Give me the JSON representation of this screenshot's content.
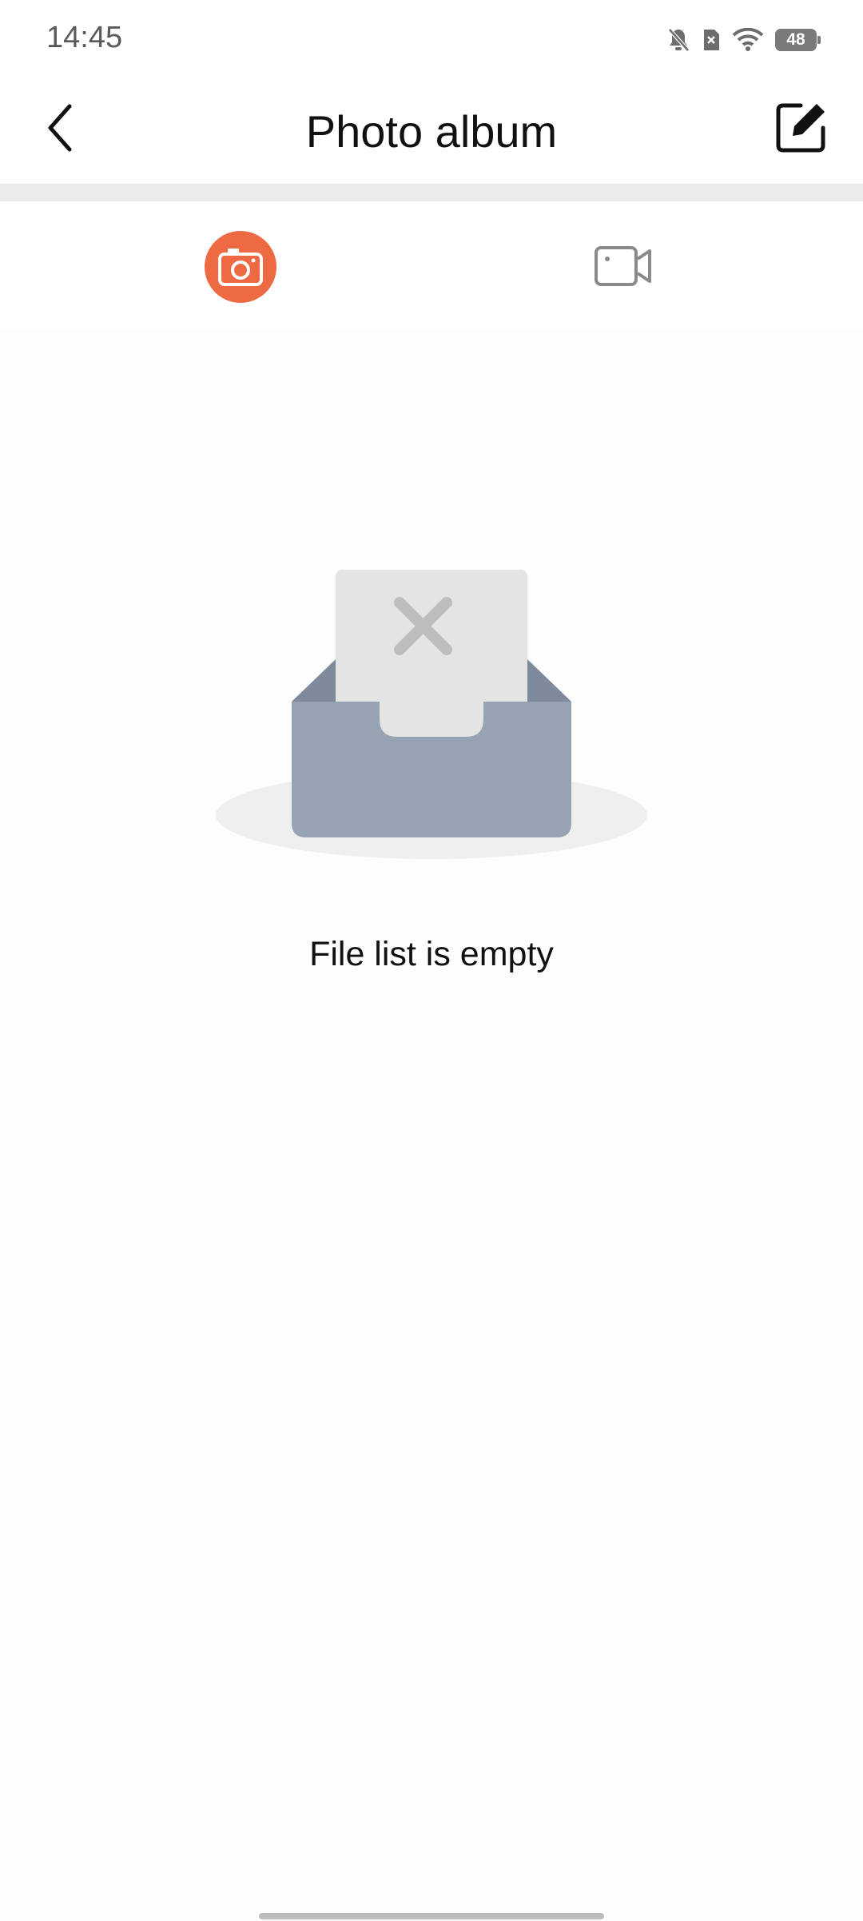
{
  "status_bar": {
    "time": "14:45",
    "battery": "48",
    "icons": [
      "bell-muted-icon",
      "sim-error-icon",
      "wifi-icon",
      "battery-icon"
    ]
  },
  "header": {
    "title": "Photo album",
    "back_icon": "chevron-left-icon",
    "edit_icon": "edit-icon"
  },
  "tabs": [
    {
      "id": "photo",
      "icon": "camera-icon",
      "active": true
    },
    {
      "id": "video",
      "icon": "video-camera-icon",
      "active": false
    }
  ],
  "empty_state": {
    "illustration": "empty-inbox-illustration",
    "message": "File list is empty"
  },
  "colors": {
    "accent": "#ee6a43",
    "divider": "#ebebeb",
    "inactive_icon": "#8a8a8a",
    "tray": "#96a3b3"
  }
}
